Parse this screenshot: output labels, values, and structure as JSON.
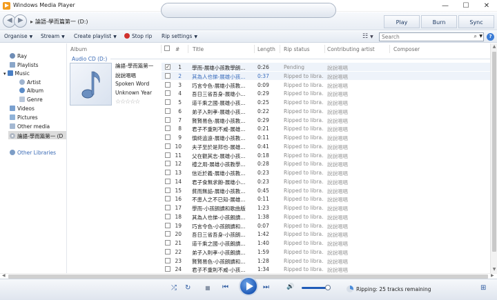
{
  "window": {
    "title": "Windows Media Player",
    "minimize": "—",
    "maximize": "☐",
    "close": "✕"
  },
  "nav": {
    "back": "◀",
    "forward": "▶",
    "breadcrumb_arrow": "▸",
    "breadcrumb": "論語-學而篇第一 (D:)",
    "tabs": [
      "Play",
      "Burn",
      "Sync"
    ]
  },
  "toolbar": {
    "organise": "Organise",
    "stream": "Stream",
    "create_playlist": "Create playlist",
    "stop_rip": "Stop rip",
    "rip_settings": "Rip settings",
    "search_placeholder": "Search",
    "caret": "▼",
    "view_icon": "☷",
    "search_icon": "⌕",
    "help": "?"
  },
  "sidebar": {
    "items": [
      {
        "label": "Ray",
        "icon": "user-icon"
      },
      {
        "label": "Playlists",
        "icon": "playlist-icon"
      },
      {
        "label": "Music",
        "icon": "music-icon",
        "expanded": "▾"
      },
      {
        "label": "Artist",
        "icon": "artist-icon"
      },
      {
        "label": "Album",
        "icon": "album-icon"
      },
      {
        "label": "Genre",
        "icon": "genre-icon"
      },
      {
        "label": "Videos",
        "icon": "video-icon"
      },
      {
        "label": "Pictures",
        "icon": "picture-icon"
      },
      {
        "label": "Other media",
        "icon": "media-icon"
      },
      {
        "label": "論語-學而篇第一 (D",
        "icon": "cd-icon",
        "selected": true
      },
      {
        "label": "Other Libraries",
        "icon": "libraries-icon"
      }
    ]
  },
  "columns": {
    "album": "Album",
    "num": "#",
    "title": "Title",
    "length": "Length",
    "rip_status": "Rip status",
    "contributing_artist": "Contributing artist",
    "composer": "Composer"
  },
  "group_label": "Audio CD (D:)",
  "album": {
    "title": "論語-學而篇第一",
    "artist": "說說唱唱",
    "genre": "Spoken Word",
    "year": "Unknown Year",
    "rating": "☆☆☆☆☆"
  },
  "tracks": [
    {
      "num": "1",
      "title": "學而-展雄小孩教學朗...",
      "length": "0:26",
      "status": "Pending",
      "artist": "說說唱唱",
      "checked": "✓"
    },
    {
      "num": "2",
      "title": "其為人也悌-展雄小孩...",
      "length": "0:37",
      "status": "Ripped to libra...",
      "artist": "說說唱唱",
      "checked": ""
    },
    {
      "num": "3",
      "title": "巧言令色-展雄小孩教...",
      "length": "0:09",
      "status": "Ripped to libra...",
      "artist": "說說唱唱",
      "checked": ""
    },
    {
      "num": "4",
      "title": "吾日三省吾身-展雄小...",
      "length": "0:29",
      "status": "Ripped to libra...",
      "artist": "說說唱唱",
      "checked": ""
    },
    {
      "num": "5",
      "title": "道千乘之國-展雄小孩...",
      "length": "0:25",
      "status": "Ripped to libra...",
      "artist": "說說唱唱",
      "checked": ""
    },
    {
      "num": "6",
      "title": "弟子入則孝-展雄小孩...",
      "length": "0:22",
      "status": "Ripped to libra...",
      "artist": "說說唱唱",
      "checked": ""
    },
    {
      "num": "7",
      "title": "賢賢易色-展雄小孩教...",
      "length": "0:29",
      "status": "Ripped to libra...",
      "artist": "說說唱唱",
      "checked": ""
    },
    {
      "num": "8",
      "title": "君子不重則不威-展雄...",
      "length": "0:21",
      "status": "Ripped to libra...",
      "artist": "說說唱唱",
      "checked": ""
    },
    {
      "num": "9",
      "title": "慎終追遠-展雄小孩教...",
      "length": "0:11",
      "status": "Ripped to libra...",
      "artist": "說說唱唱",
      "checked": ""
    },
    {
      "num": "10",
      "title": "夫子至於是邦也-展雄...",
      "length": "0:41",
      "status": "Ripped to libra...",
      "artist": "說說唱唱",
      "checked": ""
    },
    {
      "num": "11",
      "title": "父在觀其志-展雄小孩...",
      "length": "0:18",
      "status": "Ripped to libra...",
      "artist": "說說唱唱",
      "checked": ""
    },
    {
      "num": "12",
      "title": "禮之用-展雄小孩教學...",
      "length": "0:28",
      "status": "Ripped to libra...",
      "artist": "說說唱唱",
      "checked": ""
    },
    {
      "num": "13",
      "title": "信近於義-展雄小孩教...",
      "length": "0:23",
      "status": "Ripped to libra...",
      "artist": "說說唱唱",
      "checked": ""
    },
    {
      "num": "14",
      "title": "君子食無求飽-展雄小...",
      "length": "0:23",
      "status": "Ripped to libra...",
      "artist": "說說唱唱",
      "checked": ""
    },
    {
      "num": "15",
      "title": "貧而無諂-展雄小孩教...",
      "length": "0:45",
      "status": "Ripped to libra...",
      "artist": "說說唱唱",
      "checked": ""
    },
    {
      "num": "16",
      "title": "不患人之不已知-展雄...",
      "length": "0:11",
      "status": "Ripped to libra...",
      "artist": "說說唱唱",
      "checked": ""
    },
    {
      "num": "17",
      "title": "學而-小孩朗讀和歌曲版",
      "length": "1:23",
      "status": "Ripped to libra...",
      "artist": "說說唱唱",
      "checked": ""
    },
    {
      "num": "18",
      "title": "其為人也悌-小孩朗讀...",
      "length": "1:38",
      "status": "Ripped to libra...",
      "artist": "說說唱唱",
      "checked": ""
    },
    {
      "num": "19",
      "title": "巧言令色-小孩朗讀和...",
      "length": "0:07",
      "status": "Ripped to libra...",
      "artist": "說說唱唱",
      "checked": ""
    },
    {
      "num": "20",
      "title": "吾日三省吾身-小孩朗...",
      "length": "1:42",
      "status": "Ripped to libra...",
      "artist": "說說唱唱",
      "checked": ""
    },
    {
      "num": "21",
      "title": "道千乘之國-小孩朗讀...",
      "length": "1:40",
      "status": "Ripped to libra...",
      "artist": "說說唱唱",
      "checked": ""
    },
    {
      "num": "22",
      "title": "弟子入則孝-小孩朗讀...",
      "length": "1:59",
      "status": "Ripped to libra...",
      "artist": "說說唱唱",
      "checked": ""
    },
    {
      "num": "23",
      "title": "賢賢易色-小孩朗讀和...",
      "length": "1:28",
      "status": "Ripped to libra...",
      "artist": "說說唱唱",
      "checked": ""
    },
    {
      "num": "24",
      "title": "君子不重則不威-小孩...",
      "length": "1:34",
      "status": "Ripped to libra...",
      "artist": "說說唱唱",
      "checked": ""
    }
  ],
  "active_track": 1,
  "player": {
    "shuffle": "⤮",
    "repeat": "↻",
    "stop": "■",
    "prev": "⏮",
    "next": "⏭",
    "volume_icon": "🔊",
    "volume_level": 0.9,
    "switch_icon": "⊞",
    "status": "Ripping: 25 tracks remaining"
  },
  "colors": {
    "accent": "#1f5bb8",
    "link": "#3a6ab5",
    "stop": "#d0312d"
  }
}
